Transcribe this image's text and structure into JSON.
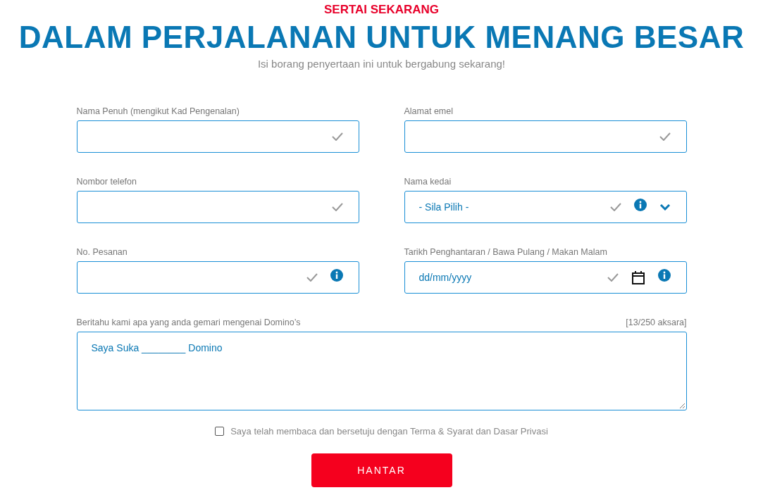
{
  "header": {
    "kicker": "SERTAI SEKARANG",
    "title": "DALAM PERJALANAN UNTUK MENANG BESAR",
    "subtitle": "Isi borang penyertaan ini untuk bergabung sekarang!"
  },
  "fields": [
    {
      "label": "Nama Penuh (mengikut Kad Pengenalan)",
      "kind": "text",
      "info": false
    },
    {
      "label": "Alamat emel",
      "kind": "text",
      "info": false
    },
    {
      "label": "Nombor telefon",
      "kind": "text",
      "info": false
    },
    {
      "label": "Nama kedai",
      "kind": "select",
      "value": "- Sila Pilih -",
      "info": true
    },
    {
      "label": "No. Pesanan",
      "kind": "text",
      "info": true
    },
    {
      "label": "Tarikh Penghantaran / Bawa Pulang / Makan Malam",
      "kind": "date",
      "value": "dd/mm/yyyy",
      "info": true
    }
  ],
  "message": {
    "label": "Beritahu kami apa yang anda gemari mengenai Domino’s",
    "counter": "[13/250 aksara]",
    "value": "Saya Suka ________ Domino"
  },
  "agree": {
    "label": "Saya telah membaca dan bersetuju dengan Terma & Syarat dan Dasar Privasi",
    "checked": false
  },
  "submit": "HANTAR"
}
